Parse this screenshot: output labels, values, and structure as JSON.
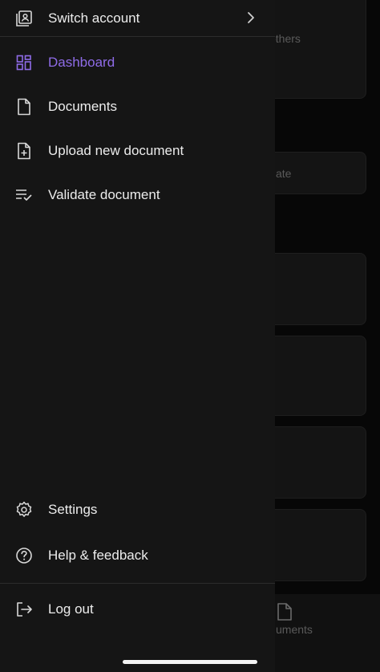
{
  "drawer": {
    "switch_account": "Switch account",
    "nav": [
      {
        "label": "Dashboard",
        "icon": "dashboard-icon",
        "active": true
      },
      {
        "label": "Documents",
        "icon": "document-icon",
        "active": false
      },
      {
        "label": "Upload new document",
        "icon": "upload-document-icon",
        "active": false
      },
      {
        "label": "Validate document",
        "icon": "validate-list-icon",
        "active": false
      }
    ],
    "settings": "Settings",
    "help": "Help & feedback",
    "logout": "Log out"
  },
  "background": {
    "partial_text_1": "others",
    "partial_text_2": "ate",
    "partial_tab": "uments"
  },
  "colors": {
    "accent": "#8f6ce8",
    "drawer_bg": "#151515"
  }
}
